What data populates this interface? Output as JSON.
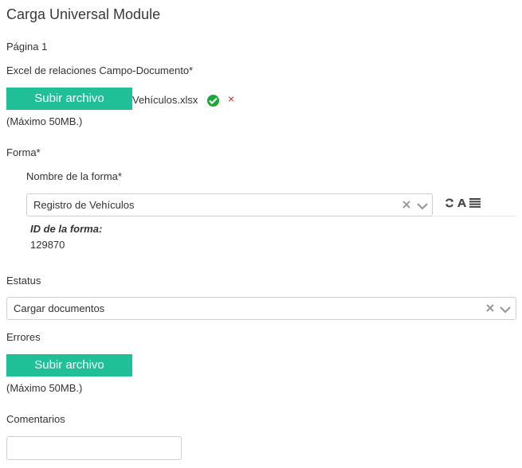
{
  "page": {
    "title": "Carga Universal Module",
    "page_label": "Página 1"
  },
  "excel": {
    "label": "Excel de relaciones Campo-Documento*",
    "upload_button": "Subir archivo",
    "file_name": "Vehículos.xlsx",
    "remove_symbol": "×",
    "max_size": "(Máximo 50MB.)"
  },
  "forma": {
    "label": "Forma*",
    "name_label": "Nombre de la forma*",
    "selected_value": "Registro de Vehículos",
    "id_label": "ID de la forma:",
    "id_value": "129870",
    "tool_icons": [
      "refresh-icon",
      "font-icon",
      "list-icon"
    ]
  },
  "estatus": {
    "label": "Estatus",
    "selected_value": "Cargar documentos"
  },
  "errores": {
    "label": "Errores",
    "upload_button": "Subir archivo",
    "max_size": "(Máximo 50MB.)"
  },
  "comentarios": {
    "label": "Comentarios",
    "value": ""
  },
  "colors": {
    "accent": "#1fbf98",
    "success": "#18a836",
    "danger": "#e02424"
  }
}
